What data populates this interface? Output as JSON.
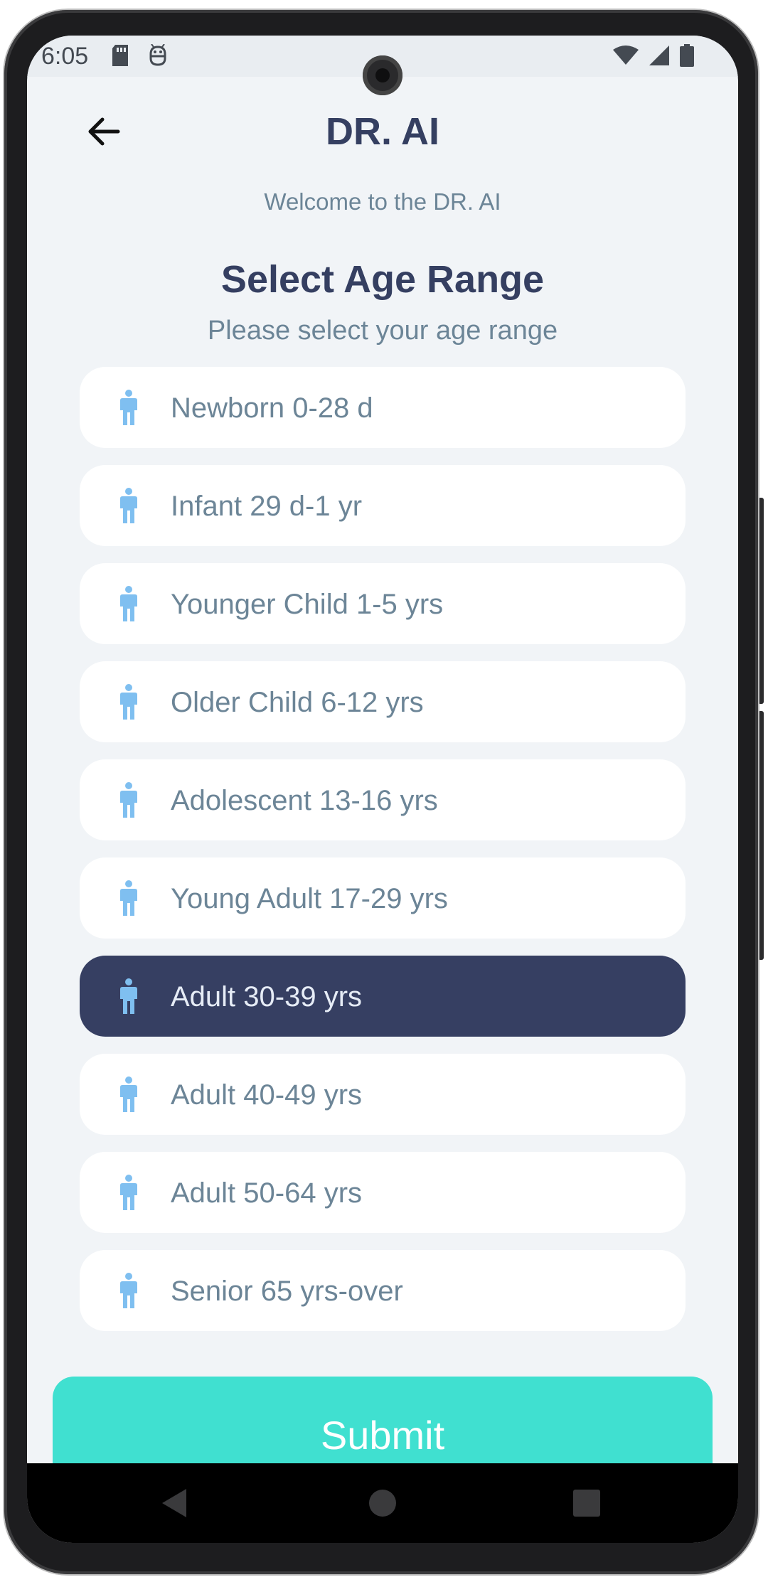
{
  "status_bar": {
    "time": "6:05",
    "left_icons": [
      "sd-card-icon",
      "android-debug-icon"
    ],
    "right_icons": [
      "wifi-icon",
      "signal-icon",
      "battery-icon"
    ]
  },
  "header": {
    "back_icon": "arrow-left-icon",
    "title": "DR. AI",
    "welcome": "Welcome to the DR. AI"
  },
  "section": {
    "title": "Select Age Range",
    "subtitle": "Please select your age range"
  },
  "age_options": [
    {
      "label": "Newborn 0-28 d",
      "selected": false
    },
    {
      "label": "Infant 29 d-1 yr",
      "selected": false
    },
    {
      "label": "Younger Child 1-5 yrs",
      "selected": false
    },
    {
      "label": "Older Child 6-12 yrs",
      "selected": false
    },
    {
      "label": "Adolescent 13-16 yrs",
      "selected": false
    },
    {
      "label": "Young Adult 17-29 yrs",
      "selected": false
    },
    {
      "label": "Adult 30-39 yrs",
      "selected": true
    },
    {
      "label": "Adult 40-49 yrs",
      "selected": false
    },
    {
      "label": "Adult 50-64 yrs",
      "selected": false
    },
    {
      "label": "Senior 65 yrs-over",
      "selected": false
    }
  ],
  "option_icon": "person-icon",
  "submit": {
    "label": "Submit"
  },
  "nav_bar": {
    "icons": [
      "nav-back-icon",
      "nav-home-icon",
      "nav-recents-icon"
    ]
  },
  "colors": {
    "background": "#f1f4f7",
    "primary_text": "#353f61",
    "secondary_text": "#6c8597",
    "selected_item": "#363f62",
    "person_icon": "#7fbff0",
    "submit_button": "#40e0d0",
    "card": "#ffffff"
  }
}
